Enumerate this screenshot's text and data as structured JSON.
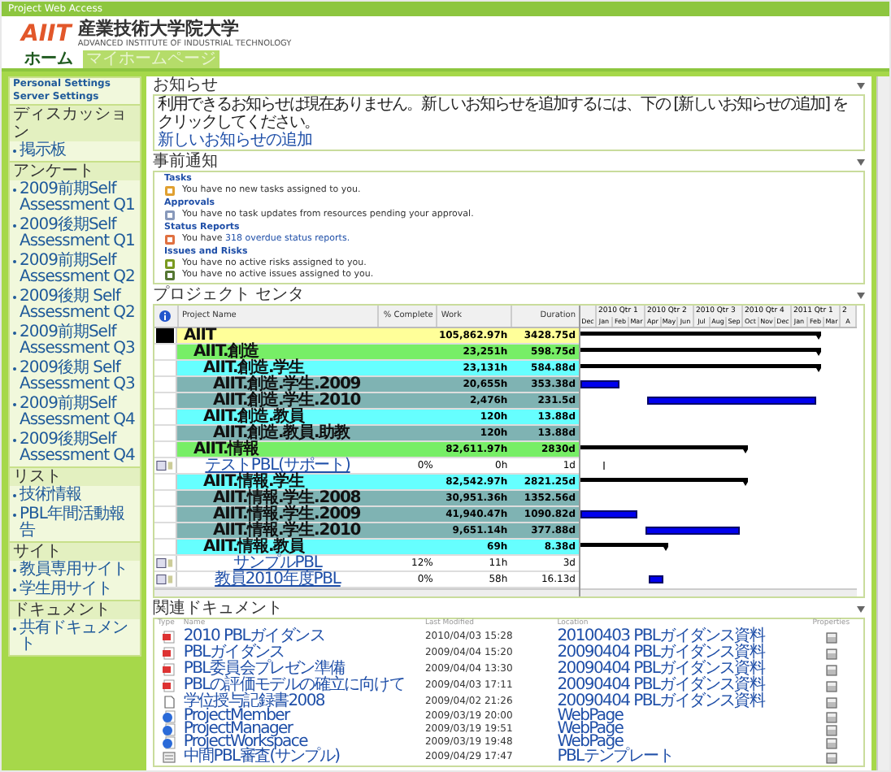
{
  "window": {
    "title": "Project Web Access"
  },
  "logo": {
    "mark": "AIIT",
    "name": "産業技術大学院大学",
    "subtitle": "ADVANCED INSTITUTE OF INDUSTRIAL TECHNOLOGY"
  },
  "nav": [
    {
      "label": "ホーム",
      "selected": false
    },
    {
      "label": "マイホームページ",
      "selected": true
    }
  ],
  "sidebar": {
    "links": [
      "Personal Settings",
      "Server Settings"
    ],
    "groups": [
      {
        "title": "ディスカッション",
        "items": [
          "掲示板"
        ]
      },
      {
        "title": "アンケート",
        "items": [
          "2009前期Self Assessment Q1",
          "2009後期Self Assessment Q1",
          "2009前期Self Assessment Q2",
          "2009後期 Self Assessment Q2",
          "2009前期Self Assessment Q3",
          "2009後期 Self Assessment Q3",
          "2009前期Self Assessment Q4",
          "2009後期Self Assessment Q4"
        ]
      },
      {
        "title": "リスト",
        "items": [
          "技術情報",
          "PBL年間活動報告"
        ]
      },
      {
        "title": "サイト",
        "items": [
          "教員専用サイト",
          "学生用サイト"
        ]
      },
      {
        "title": "ドキュメント",
        "items": [
          "共有ドキュメント"
        ]
      }
    ]
  },
  "announcements": {
    "title": "お知らせ",
    "message": "利用できるお知らせは現在ありません。新しいお知らせを追加するには、下の [新しいお知らせの追加] をクリックしてください。",
    "link": "新しいお知らせの追加"
  },
  "reminders": {
    "title": "事前通知",
    "groups": [
      {
        "title": "Tasks",
        "lines": [
          {
            "kind": "task",
            "text": "You have no new tasks assigned to you."
          }
        ]
      },
      {
        "title": "Approvals",
        "lines": [
          {
            "kind": "approval",
            "text": "You have no task updates from resources pending your approval."
          }
        ]
      },
      {
        "title": "Status Reports",
        "lines": [
          {
            "kind": "report",
            "text": "You have ",
            "link": "318 overdue status reports."
          }
        ]
      },
      {
        "title": "Issues and Risks",
        "lines": [
          {
            "kind": "risk",
            "text": "You have no active risks assigned to you."
          },
          {
            "kind": "issue",
            "text": "You have no active issues assigned to you."
          }
        ]
      }
    ]
  },
  "project_center": {
    "title": "プロジェクト センタ",
    "columns": [
      "Project Name",
      "% Complete",
      "Work",
      "Duration"
    ],
    "quarters": [
      "2010 Qtr 1",
      "2010 Qtr 2",
      "2010 Qtr 3",
      "2010 Qtr 4",
      "2011 Qtr 1",
      "2"
    ],
    "months": [
      "Dec",
      "Jan",
      "Feb",
      "Mar",
      "Apr",
      "May",
      "Jun",
      "Jul",
      "Aug",
      "Sep",
      "Oct",
      "Nov",
      "Dec",
      "Jan",
      "Feb",
      "Mar",
      "A"
    ],
    "rows": [
      {
        "kind": "root",
        "name": "AIIT",
        "work": "105,862.97h",
        "duration": "3428.75d",
        "bar": {
          "kind": "summary"
        }
      },
      {
        "kind": "division",
        "name": "AIIT.創造",
        "work": "23,251h",
        "duration": "598.75d",
        "bar": {
          "kind": "summary"
        }
      },
      {
        "kind": "group",
        "name": "AIIT.創造.学生",
        "work": "23,131h",
        "duration": "584.88d",
        "bar": {
          "kind": "summary"
        }
      },
      {
        "kind": "subgroup",
        "name": "AIIT.創造.学生.2009",
        "work": "20,655h",
        "duration": "353.38d",
        "bar": {
          "kind": "task"
        }
      },
      {
        "kind": "subgroup",
        "name": "AIIT.創造.学生.2010",
        "work": "2,476h",
        "duration": "231.5d",
        "bar": {
          "kind": "task"
        }
      },
      {
        "kind": "group",
        "name": "AIIT.創造.教員",
        "work": "120h",
        "duration": "13.88d"
      },
      {
        "kind": "subgroup",
        "name": "AIIT.創造.教員.助教",
        "work": "120h",
        "duration": "13.88d"
      },
      {
        "kind": "division",
        "name": "AIIT.情報",
        "work": "82,611.97h",
        "duration": "2830d",
        "bar": {
          "kind": "summary"
        }
      },
      {
        "kind": "task",
        "name": "テストPBL(サポート)",
        "complete": "0%",
        "work": "0h",
        "duration": "1d",
        "bar": {
          "kind": "milestone"
        }
      },
      {
        "kind": "group",
        "name": "AIIT.情報.学生",
        "work": "82,542.97h",
        "duration": "2821.25d",
        "bar": {
          "kind": "summary"
        }
      },
      {
        "kind": "subgroup",
        "name": "AIIT.情報.学生.2008",
        "work": "30,951.36h",
        "duration": "1352.56d"
      },
      {
        "kind": "subgroup",
        "name": "AIIT.情報.学生.2009",
        "work": "41,940.47h",
        "duration": "1090.82d",
        "bar": {
          "kind": "task"
        }
      },
      {
        "kind": "subgroup",
        "name": "AIIT.情報.学生.2010",
        "work": "9,651.14h",
        "duration": "377.88d",
        "bar": {
          "kind": "task"
        }
      },
      {
        "kind": "group",
        "name": "AIIT.情報.教員",
        "work": "69h",
        "duration": "8.38d",
        "bar": {
          "kind": "summary"
        }
      },
      {
        "kind": "task",
        "name": "サンプルPBL",
        "complete": "12%",
        "work": "11h",
        "duration": "3d"
      },
      {
        "kind": "task",
        "name": "教員2010年度PBL",
        "complete": "0%",
        "work": "58h",
        "duration": "16.13d",
        "bar": {
          "kind": "task"
        }
      }
    ]
  },
  "documents": {
    "title": "関連ドキュメント",
    "columns": [
      "Type",
      "Name",
      "Last Modified",
      "Location",
      "Properties"
    ],
    "rows": [
      {
        "kind": "presentation",
        "name": "2010 PBLガイダンス",
        "modified": "2010/04/03 15:28",
        "location": "20100403 PBLガイダンス資料"
      },
      {
        "kind": "presentation",
        "name": "PBLガイダンス",
        "modified": "2009/04/04 15:20",
        "location": "20090404 PBLガイダンス資料"
      },
      {
        "kind": "presentation",
        "name": "PBL委員会プレゼン準備",
        "modified": "2009/04/04 13:30",
        "location": "20090404 PBLガイダンス資料"
      },
      {
        "kind": "presentation",
        "name": "PBLの評価モデルの確立に向けて",
        "modified": "2009/04/03 17:11",
        "location": "20090404 PBLガイダンス資料"
      },
      {
        "kind": "document",
        "name": "学位授与記録書2008",
        "modified": "2009/04/02 21:26",
        "location": "20090404 PBLガイダンス資料"
      },
      {
        "kind": "webpage",
        "name": "ProjectMember",
        "modified": "2009/03/19 20:00",
        "location": "WebPage"
      },
      {
        "kind": "webpage",
        "name": "ProjectManager",
        "modified": "2009/03/19 19:51",
        "location": "WebPage"
      },
      {
        "kind": "webpage",
        "name": "ProjectWorkspace",
        "modified": "2009/03/19 19:48",
        "location": "WebPage"
      },
      {
        "kind": "template",
        "name": "中間PBL審査(サンプル)",
        "modified": "2009/04/29 17:47",
        "location": "PBLテンプレート"
      }
    ]
  }
}
